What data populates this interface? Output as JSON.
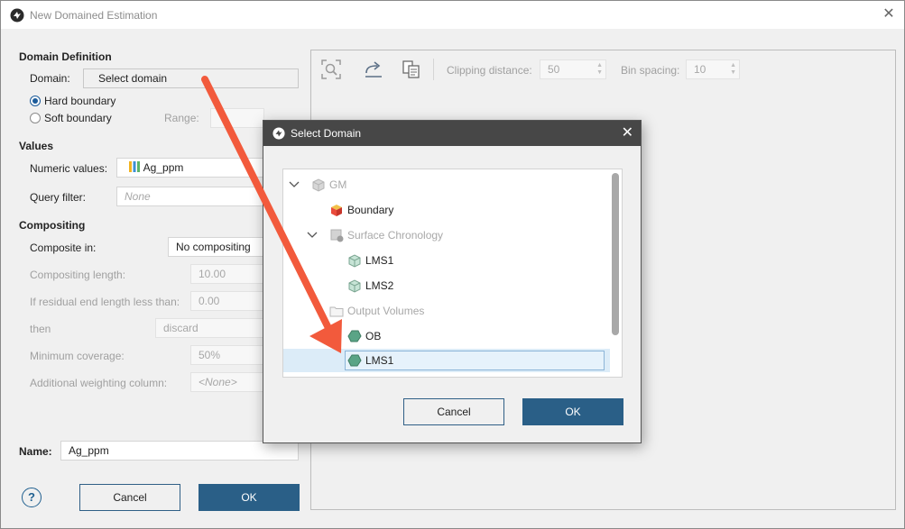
{
  "window": {
    "title": "New Domained Estimation",
    "close_symbol": "✕"
  },
  "domain_definition": {
    "title": "Domain Definition",
    "domain_label": "Domain:",
    "domain_value": "Select domain",
    "hard_boundary": "Hard boundary",
    "soft_boundary": "Soft boundary",
    "range_label": "Range:",
    "boundary_selected": "hard"
  },
  "values": {
    "title": "Values",
    "numeric_label": "Numeric values:",
    "numeric_value": "Ag_ppm",
    "query_label": "Query filter:",
    "query_value": "None"
  },
  "compositing": {
    "title": "Compositing",
    "composite_in_label": "Composite in:",
    "composite_in_value": "No compositing",
    "length_label": "Compositing length:",
    "length_value": "10.00",
    "residual_label": "If residual end length less than:",
    "residual_value": "0.00",
    "then_label": "then",
    "then_value": "discard",
    "min_cov_label": "Minimum coverage:",
    "min_cov_value": "50%",
    "weight_label": "Additional weighting column:",
    "weight_value": "<None>"
  },
  "name": {
    "label": "Name:",
    "value": "Ag_ppm"
  },
  "footer": {
    "help": "?",
    "cancel": "Cancel",
    "ok": "OK"
  },
  "viewer_toolbar": {
    "clipping_label": "Clipping distance:",
    "clipping_value": "50",
    "bin_label": "Bin spacing:",
    "bin_value": "10"
  },
  "select_domain_dialog": {
    "title": "Select Domain",
    "close_symbol": "✕",
    "tree": [
      {
        "label": "GM",
        "enabled": false,
        "icon": "geological-model-icon"
      },
      {
        "label": "Boundary",
        "enabled": true,
        "icon": "boundary-icon"
      },
      {
        "label": "Surface Chronology",
        "enabled": false,
        "icon": "surface-chronology-icon"
      },
      {
        "label": "LMS1",
        "enabled": true,
        "icon": "lithology-volume-icon"
      },
      {
        "label": "LMS2",
        "enabled": true,
        "icon": "lithology-volume-icon"
      },
      {
        "label": "Output Volumes",
        "enabled": false,
        "icon": "folder-icon"
      },
      {
        "label": "OB",
        "enabled": true,
        "icon": "output-volume-icon"
      },
      {
        "label": "LMS1",
        "enabled": true,
        "icon": "output-volume-icon",
        "selected": true
      }
    ],
    "cancel": "Cancel",
    "ok": "OK"
  },
  "colors": {
    "accent": "#2a5f87",
    "selection": "#dcecf8",
    "arrow": "#f25a3c",
    "volume_green": "#5aa486"
  }
}
